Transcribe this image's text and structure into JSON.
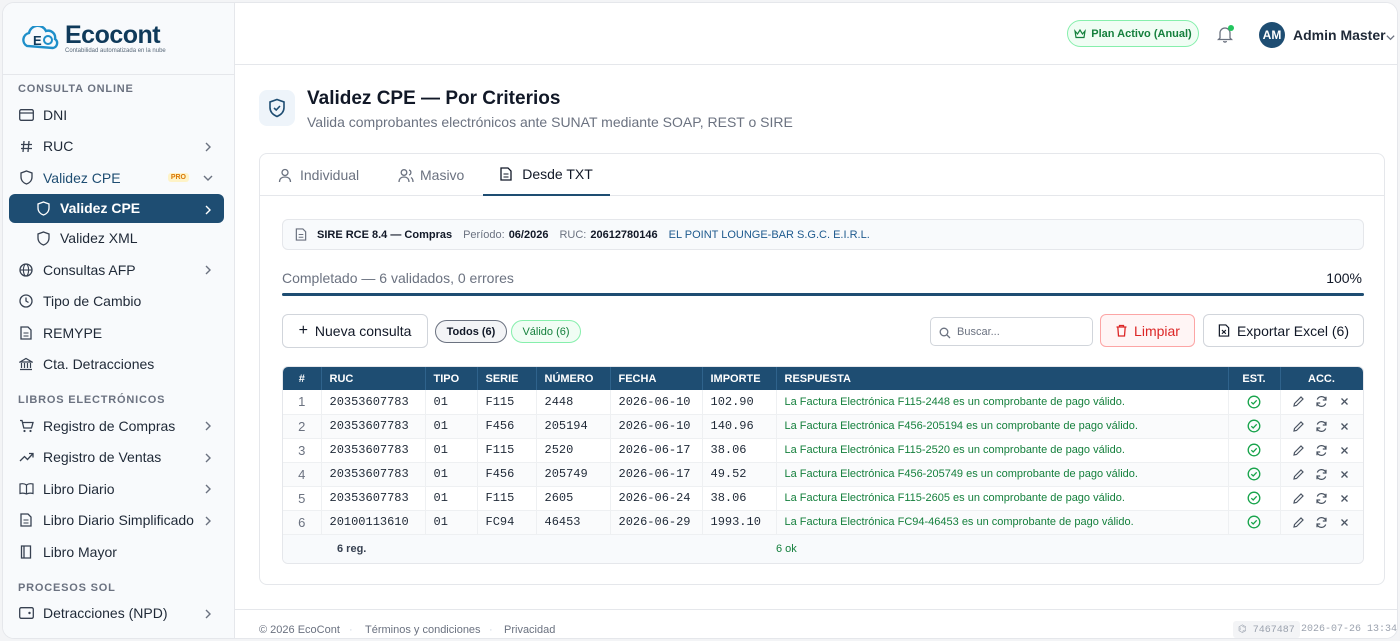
{
  "brand": {
    "name": "Ecocont",
    "tagline": "Contabilidad automatizada en la nube"
  },
  "sidebar": {
    "sections": [
      {
        "title": "CONSULTA ONLINE"
      },
      {
        "title": "LIBROS ELECTRÓNICOS"
      },
      {
        "title": "PROCESOS SOL"
      }
    ],
    "items": {
      "dni": "DNI",
      "ruc": "RUC",
      "validez_cpe": "Validez CPE",
      "validez_cpe_badge": "PRO",
      "validez_cpe_sub": "Validez CPE",
      "validez_xml": "Validez XML",
      "consultas_afp": "Consultas AFP",
      "tipo_cambio": "Tipo de Cambio",
      "remype": "REMYPE",
      "cta_detracciones": "Cta. Detracciones",
      "registro_compras": "Registro de Compras",
      "registro_ventas": "Registro de Ventas",
      "libro_diario": "Libro Diario",
      "libro_diario_simplificado": "Libro Diario Simplificado",
      "libro_mayor": "Libro Mayor",
      "detracciones_npd": "Detracciones (NPD)"
    }
  },
  "header": {
    "plan": "Plan Activo (Anual)",
    "avatar_initials": "AM",
    "user_name": "Admin Master"
  },
  "page": {
    "title": "Validez CPE — Por Criterios",
    "subtitle": "Valida comprobantes electrónicos ante SUNAT mediante SOAP, REST o SIRE"
  },
  "tabs": {
    "individual": "Individual",
    "masivo": "Masivo",
    "desde_txt": "Desde TXT"
  },
  "info": {
    "source": "SIRE RCE 8.4 — Compras",
    "period_label": "Período:",
    "period_value": "06/2026",
    "ruc_label": "RUC:",
    "ruc_value": "20612780146",
    "company": "EL POINT LOUNGE-BAR S.G.C. E.I.R.L."
  },
  "progress": {
    "text": "Completado — 6 validados, 0 errores",
    "percent_label": "100%",
    "fraction": 1.0
  },
  "toolbar": {
    "new_query": "Nueva consulta",
    "filter_all": "Todos (6)",
    "filter_valid": "Válido (6)",
    "search_placeholder": "Buscar...",
    "clear": "Limpiar",
    "export": "Exportar Excel (6)"
  },
  "table": {
    "columns": {
      "num": "#",
      "ruc": "RUC",
      "tipo": "TIPO",
      "serie": "SERIE",
      "numero": "NÚMERO",
      "fecha": "FECHA",
      "importe": "IMPORTE",
      "respuesta": "RESPUESTA",
      "est": "EST.",
      "acc": "ACC."
    },
    "rows": [
      {
        "n": "1",
        "ruc": "20353607783",
        "tipo": "01",
        "serie": "F115",
        "numero": "2448",
        "fecha": "2026-06-10",
        "importe": "102.90",
        "respuesta": "La Factura Electrónica F115-2448 es un comprobante de pago válido."
      },
      {
        "n": "2",
        "ruc": "20353607783",
        "tipo": "01",
        "serie": "F456",
        "numero": "205194",
        "fecha": "2026-06-10",
        "importe": "140.96",
        "respuesta": "La Factura Electrónica F456-205194 es un comprobante de pago válido."
      },
      {
        "n": "3",
        "ruc": "20353607783",
        "tipo": "01",
        "serie": "F115",
        "numero": "2520",
        "fecha": "2026-06-17",
        "importe": "38.06",
        "respuesta": "La Factura Electrónica F115-2520 es un comprobante de pago válido."
      },
      {
        "n": "4",
        "ruc": "20353607783",
        "tipo": "01",
        "serie": "F456",
        "numero": "205749",
        "fecha": "2026-06-17",
        "importe": "49.52",
        "respuesta": "La Factura Electrónica F456-205749 es un comprobante de pago válido."
      },
      {
        "n": "5",
        "ruc": "20353607783",
        "tipo": "01",
        "serie": "F115",
        "numero": "2605",
        "fecha": "2026-06-24",
        "importe": "38.06",
        "respuesta": "La Factura Electrónica F115-2605 es un comprobante de pago válido."
      },
      {
        "n": "6",
        "ruc": "20100113610",
        "tipo": "01",
        "serie": "FC94",
        "numero": "46453",
        "fecha": "2026-06-29",
        "importe": "1993.10",
        "respuesta": "La Factura Electrónica FC94-46453 es un comprobante de pago válido."
      }
    ],
    "footer": {
      "count": "6 reg.",
      "ok": "6 ok"
    }
  },
  "footer": {
    "copyright": "© 2026 EcoCont",
    "terms": "Términos y condiciones",
    "privacy": "Privacidad",
    "version": "⌬ 7467487",
    "clock": "2026-07-26 13:34"
  },
  "colors": {
    "primary": "#1e4d72",
    "success": "#15803d",
    "danger": "#dc2626"
  }
}
